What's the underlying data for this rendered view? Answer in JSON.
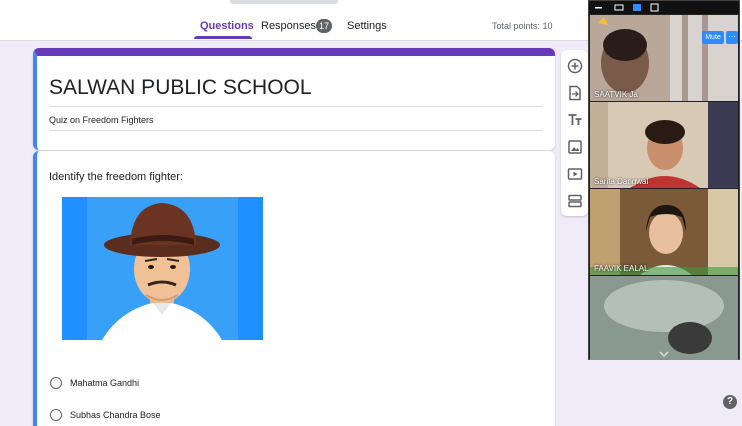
{
  "header": {
    "tabs": [
      {
        "label": "Questions",
        "active": true
      },
      {
        "label": "Responses",
        "badge": "17"
      },
      {
        "label": "Settings"
      }
    ],
    "total_points": "Total points: 10"
  },
  "form": {
    "title": "SALWAN PUBLIC SCHOOL",
    "description": "Quiz on Freedom Fighters"
  },
  "question": {
    "text": "Identify the freedom fighter:",
    "options": [
      "Mahatma Gandhi",
      "Subhas Chandra Bose"
    ]
  },
  "toolbar": {
    "tools": [
      "add-question-icon",
      "import-questions-icon",
      "add-title-icon",
      "add-image-icon",
      "add-video-icon",
      "add-section-icon"
    ]
  },
  "video_call": {
    "participants": [
      {
        "name": "SAATVIK Ja"
      },
      {
        "name": "Sarita Dangwal"
      },
      {
        "name": "FAAVIK EALAL"
      },
      {
        "name": ""
      }
    ],
    "mute_label": "Mute",
    "more_label": "···"
  },
  "help_label": "?",
  "colors": {
    "accent": "#673ab7",
    "blue": "#4285f4",
    "background": "#f0ebf8"
  }
}
